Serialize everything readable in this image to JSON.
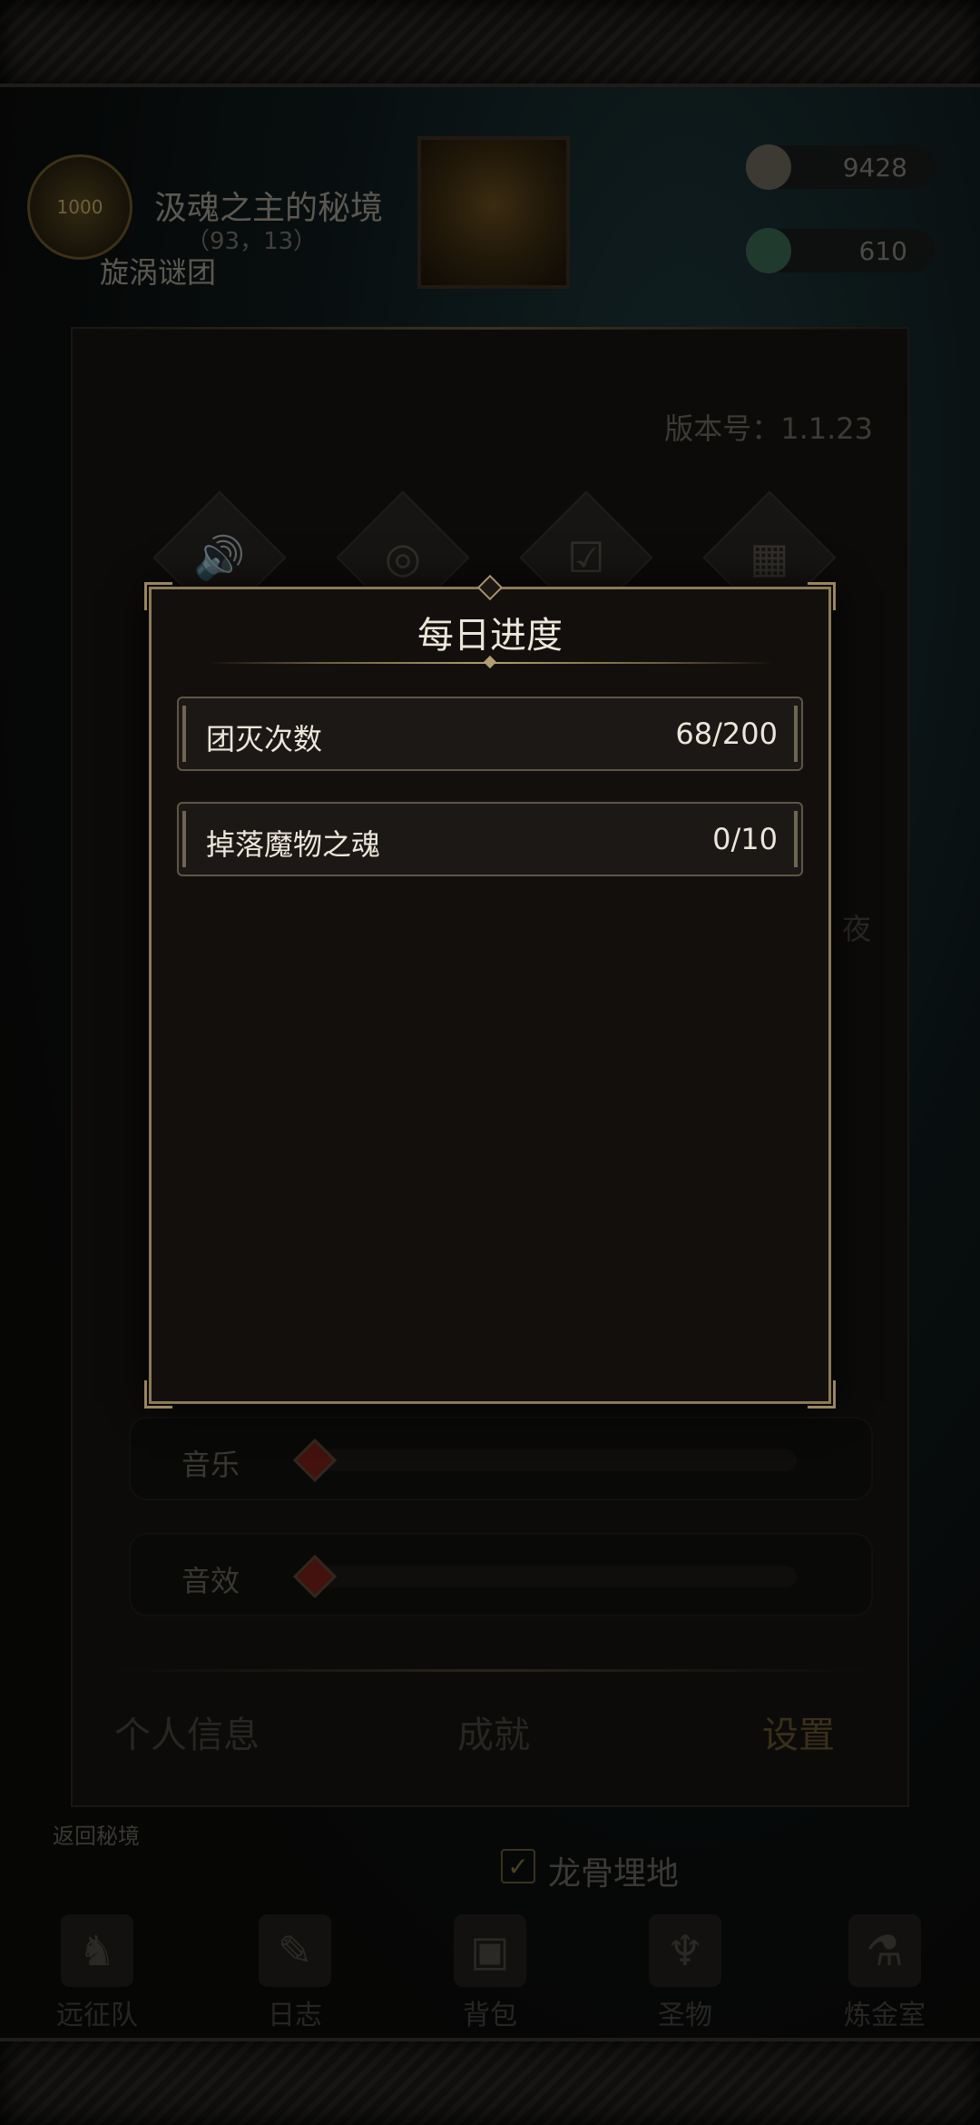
{
  "zone": {
    "emblem_text": "1000",
    "title": "汲魂之主的秘境",
    "coords": "（93，13）",
    "guild": "旋涡谜团"
  },
  "resources": {
    "gold": "9428",
    "gems": "610"
  },
  "settings_panel": {
    "version": "版本号：1.1.23",
    "icons": [
      "sound-icon",
      "compass-icon",
      "calendar-check-icon",
      "qr-code-icon"
    ],
    "partial_text": "夜",
    "sliders": [
      {
        "label": "音乐",
        "value": 0
      },
      {
        "label": "音效",
        "value": 0
      }
    ],
    "tabs": [
      "个人信息",
      "成就",
      "设置"
    ],
    "active_tab": "设置"
  },
  "return_link": "返回秘境",
  "region_name": "龙骨埋地",
  "bottom_nav": [
    "远征队",
    "日志",
    "背包",
    "圣物",
    "炼金室"
  ],
  "modal": {
    "title": "每日进度",
    "items": [
      {
        "label": "团灭次数",
        "value": "68/200"
      },
      {
        "label": "掉落魔物之魂",
        "value": "0/10"
      }
    ]
  },
  "colors": {
    "modal_border": "#8b7a58",
    "modal_bg": "#130f0c",
    "text": "#ece6da"
  }
}
